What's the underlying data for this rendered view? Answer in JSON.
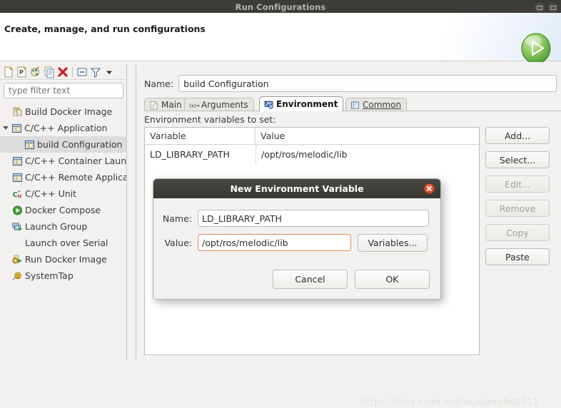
{
  "window": {
    "title": "Run Configurations",
    "minimize_icon": "minimize-icon",
    "close_icon": "window-close-icon"
  },
  "header": {
    "title": "Create, manage, and run configurations",
    "run_icon": "run-play-icon"
  },
  "sidebar": {
    "toolbar": [
      {
        "name": "new-launch-configuration-icon",
        "label": "New launch configuration"
      },
      {
        "name": "new-prototype-icon",
        "label": "New prototype"
      },
      {
        "name": "new-launch-group-icon",
        "label": "New launch group"
      },
      {
        "name": "duplicate-icon",
        "label": "Duplicate"
      },
      {
        "name": "delete-icon",
        "label": "Delete"
      },
      {
        "name": "collapse-all-icon",
        "label": "Collapse All"
      },
      {
        "name": "filter-icon",
        "label": "Filter launch configurations"
      },
      {
        "name": "view-menu-icon",
        "label": "View Menu"
      }
    ],
    "filter": {
      "placeholder": "type filter text",
      "value": ""
    },
    "tree": [
      {
        "label": "Build Docker Image",
        "icon": "docker-build-icon",
        "indent": 1,
        "twisty": "none",
        "selected": false
      },
      {
        "label": "C/C++ Application",
        "icon": "c-cpp-icon",
        "indent": 0,
        "twisty": "open",
        "selected": false
      },
      {
        "label": "build Configuration",
        "icon": "c-cpp-icon",
        "indent": 2,
        "twisty": "none",
        "selected": true
      },
      {
        "label": "C/C++ Container Launcher",
        "icon": "c-cpp-icon",
        "indent": 1,
        "twisty": "none",
        "selected": false
      },
      {
        "label": "C/C++ Remote Application",
        "icon": "c-cpp-icon",
        "indent": 1,
        "twisty": "none",
        "selected": false
      },
      {
        "label": "C/C++ Unit",
        "icon": "c-cpp-unit-icon",
        "indent": 1,
        "twisty": "none",
        "selected": false
      },
      {
        "label": "Docker Compose",
        "icon": "docker-compose-icon",
        "indent": 1,
        "twisty": "none",
        "selected": false
      },
      {
        "label": "Launch Group",
        "icon": "launch-group-icon",
        "indent": 1,
        "twisty": "none",
        "selected": false
      },
      {
        "label": "Launch over Serial",
        "icon": "none",
        "indent": 1,
        "twisty": "none",
        "selected": false
      },
      {
        "label": "Run Docker Image",
        "icon": "docker-run-icon",
        "indent": 1,
        "twisty": "none",
        "selected": false
      },
      {
        "label": "SystemTap",
        "icon": "systemtap-icon",
        "indent": 1,
        "twisty": "none",
        "selected": false
      }
    ]
  },
  "config": {
    "name_label": "Name:",
    "name_value": "build Configuration",
    "tabs": [
      {
        "label": "Main",
        "icon": "document-icon",
        "active": false
      },
      {
        "label": "Arguments",
        "icon": "arguments-icon",
        "active": false
      },
      {
        "label": "Environment",
        "icon": "environment-icon",
        "active": true
      },
      {
        "label": "Common",
        "icon": "common-icon",
        "active": false
      }
    ],
    "env_label": "Environment variables to set:",
    "table": {
      "columns": [
        "Variable",
        "Value"
      ],
      "rows": [
        {
          "variable": "LD_LIBRARY_PATH",
          "value": "/opt/ros/melodic/lib"
        }
      ]
    },
    "buttons": [
      {
        "label": "Add...",
        "enabled": true
      },
      {
        "label": "Select...",
        "enabled": true
      },
      {
        "label": "Edit...",
        "enabled": false
      },
      {
        "label": "Remove",
        "enabled": false
      },
      {
        "label": "Copy",
        "enabled": false
      },
      {
        "label": "Paste",
        "enabled": true
      }
    ]
  },
  "dialog": {
    "title": "New Environment Variable",
    "close_icon": "dialog-close-icon",
    "name_label": "Name:",
    "name_value": "LD_LIBRARY_PATH",
    "value_label": "Value:",
    "value_value": "/opt/ros/melodic/lib",
    "variables_button": "Variables...",
    "cancel_button": "Cancel",
    "ok_button": "OK"
  },
  "watermark": "https://blog.csdn.net/wuxiangfei0011",
  "colors": {
    "titlebar_bg": "#3c3b37",
    "dialog_title_bg": "#403f3a",
    "close_red": "#d2482a",
    "focus_orange": "#e08a5e",
    "selection_gray": "#dcdcdc",
    "run_green": "#68b548"
  }
}
